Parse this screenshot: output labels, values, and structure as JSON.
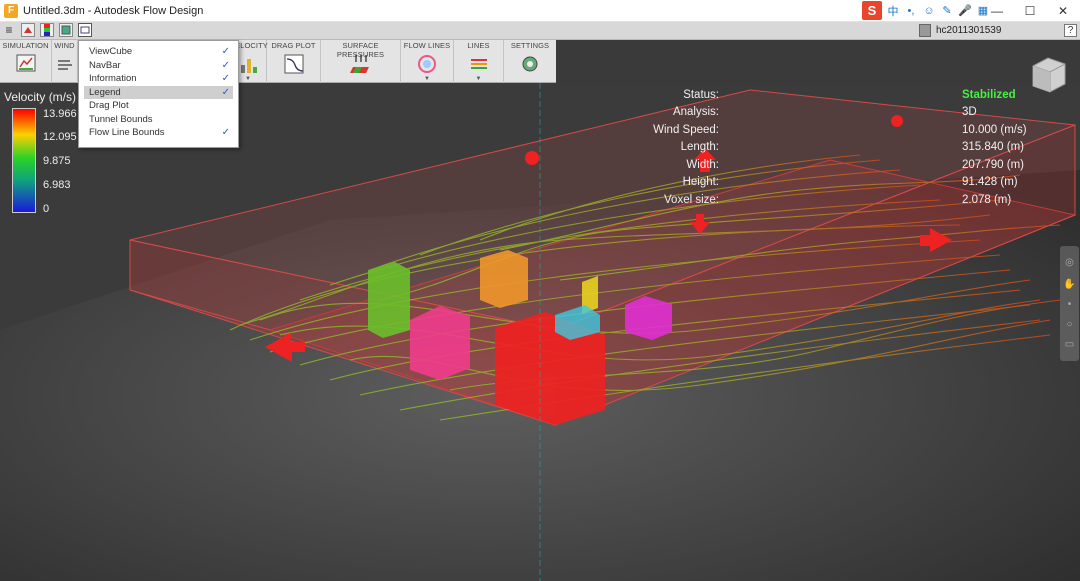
{
  "window": {
    "title": "Untitled.3dm - Autodesk Flow Design",
    "app_icon_letter": "F",
    "ime_letter": "S",
    "tray_icons": [
      "中",
      "•,",
      "☺",
      "✎",
      "🎤",
      "▦"
    ]
  },
  "controls": {
    "minimize": "—",
    "maximize": "☐",
    "close": "✕"
  },
  "appbar": {
    "user": "hc2011301539",
    "help": "?"
  },
  "ribbon": [
    {
      "label": "SIMULATION",
      "icon": "simulation-icon"
    },
    {
      "label": "WIND",
      "icon": "wind-icon"
    },
    {
      "label": "VELOCITY",
      "icon": "velocity-icon"
    },
    {
      "label": "DRAG PLOT",
      "icon": "drag-plot-icon"
    },
    {
      "label": "SURFACE PRESSURES",
      "icon": "surface-pressures-icon"
    },
    {
      "label": "FLOW LINES",
      "icon": "flow-lines-icon"
    },
    {
      "label": "LINES",
      "icon": "lines-icon"
    },
    {
      "label": "SETTINGS",
      "icon": "settings-icon"
    }
  ],
  "menu": {
    "items": [
      {
        "label": "ViewCube",
        "checked": true
      },
      {
        "label": "NavBar",
        "checked": true
      },
      {
        "label": "Information",
        "checked": true
      },
      {
        "label": "Legend",
        "checked": true,
        "active": true
      },
      {
        "label": "Drag Plot",
        "checked": false
      },
      {
        "label": "Tunnel Bounds",
        "checked": false
      },
      {
        "label": "Flow Line Bounds",
        "checked": true
      }
    ],
    "check_glyph": "✓"
  },
  "legend": {
    "title": "Velocity (m/s)",
    "values": [
      "13.966",
      "12.095",
      "9.875",
      "6.983",
      "0"
    ]
  },
  "info": {
    "status_label": "Status:",
    "status_value": "Stabilized",
    "analysis_label": "Analysis:",
    "analysis_value": "3D",
    "wind_label": "Wind Speed:",
    "wind_value": "10.000 (m/s)",
    "length_label": "Length:",
    "length_value": "315.840 (m)",
    "width_label": "Width:",
    "width_value": "207.790 (m)",
    "height_label": "Height:",
    "height_value": "91.428 (m)",
    "voxel_label": "Voxel size:",
    "voxel_value": "2.078 (m)"
  },
  "colors": {
    "status_ok": "#46f046",
    "tunnel": "#c83c3c",
    "flow_fast": "#e0501a",
    "flow_mid": "#7ab82a",
    "arrow": "#ee2222"
  }
}
